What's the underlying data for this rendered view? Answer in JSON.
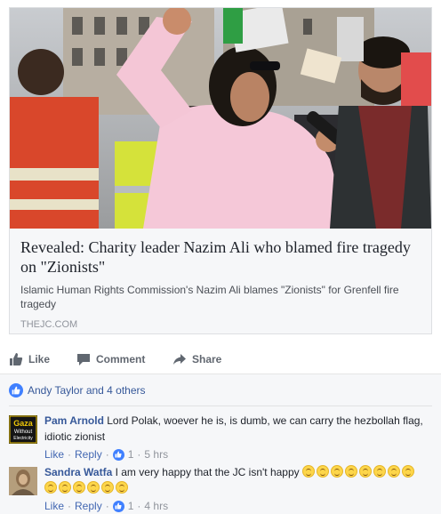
{
  "link": {
    "image_alt": "Protest photo: man in pink shirt raising arm holding microphone",
    "title": "Revealed: Charity leader Nazim Ali who blamed fire tragedy on \"Zionists\"",
    "description": "Islamic Human Rights Commission's Nazim Ali blames \"Zionists\" for Grenfell fire tragedy",
    "domain": "THEJC.COM"
  },
  "actions": {
    "like": "Like",
    "comment": "Comment",
    "share": "Share"
  },
  "reactions": {
    "summary": "Andy Taylor and 4 others"
  },
  "comments": [
    {
      "author": "Pam Arnold",
      "text": "Lord Polak, woever he is, is dumb, we can carry the hezbollah flag, idiotic zionist",
      "like_label": "Like",
      "reply_label": "Reply",
      "like_count": "1",
      "time": "5 hrs",
      "avatar_text": [
        "Gaza",
        "Without",
        "Electricity"
      ]
    },
    {
      "author": "Sandra Watfa",
      "text": "I am very happy that the JC isn't happy",
      "emoji_count": 14,
      "like_label": "Like",
      "reply_label": "Reply",
      "like_count": "1",
      "time": "4 hrs"
    }
  ],
  "colors": {
    "link_blue": "#365899",
    "like_blue": "#4080ff",
    "meta_gray": "#90949c"
  }
}
